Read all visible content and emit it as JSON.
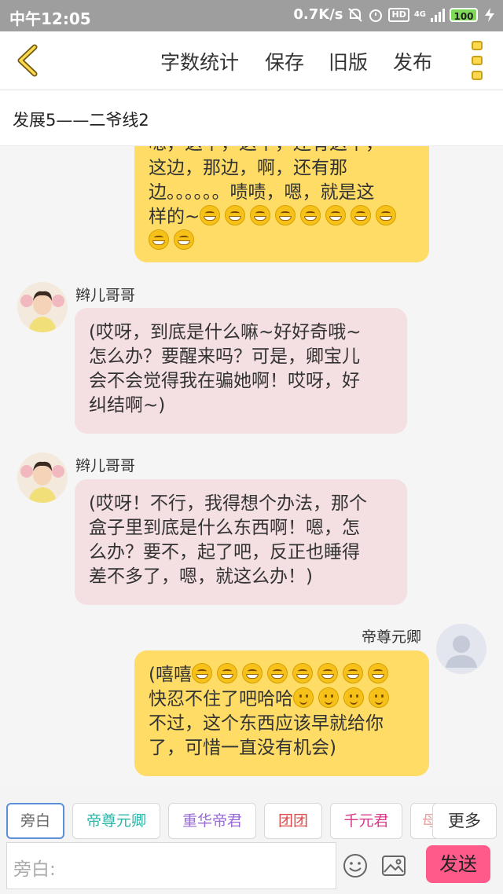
{
  "status_bar": {
    "time": "中午12:05",
    "net_speed": "0.7K/s",
    "network_type": "4G",
    "hd_badge": "HD",
    "battery": "100"
  },
  "app_bar": {
    "menu": {
      "word_count": "字数统计",
      "save": "保存",
      "old_version": "旧版",
      "publish": "发布"
    },
    "accent_color": "#ffd84d"
  },
  "chapter_title": "发展5——二爷线2",
  "messages": [
    {
      "side": "right",
      "speaker": "",
      "text": "嗯，这个，这个，还有这个，这边，那边，啊，还有那边。。。。。。啧啧，嗯，就是这样的~",
      "emoji": "grin x10",
      "color": "#ffdc66"
    },
    {
      "side": "left",
      "speaker": "辫儿哥哥",
      "text": "(哎呀，到底是什么嘛~好好奇哦~怎么办？要醒来吗？可是，卿宝儿会不会觉得我在骗她啊！哎呀，好纠结啊~)",
      "color": "#f4dfe2"
    },
    {
      "side": "left",
      "speaker": "辫儿哥哥",
      "text": "(哎呀！不行，我得想个办法，那个盒子里到底是什么东西啊！嗯，怎么办？要不，起了吧，反正也睡得差不多了，嗯，就这么办！)",
      "color": "#f4dfe2"
    },
    {
      "side": "right",
      "speaker": "帝尊元卿",
      "text_line1": "(嘻嘻",
      "text_line2": "快忍不住了吧哈哈",
      "text_line3": "不过，这个东西应该早就给你了，可惜一直没有机会)",
      "color": "#ffdc66"
    }
  ],
  "msg0_lines": [
    "嗯，这个，这个，还有这个，",
    "这边，那边，啊，还有那",
    "边。。。。。。啧啧，嗯，就是这",
    "样的~"
  ],
  "msg1_lines": [
    "(哎呀，到底是什么嘛~好好奇哦~",
    "怎么办？要醒来吗？可是，卿宝儿",
    "会不会觉得我在骗她啊！哎呀，好",
    "纠结啊~)"
  ],
  "msg2_lines": [
    "(哎呀！不行，我得想个办法，那个",
    "盒子里到底是什么东西啊！嗯，怎",
    "么办？要不，起了吧，反正也睡得",
    "差不多了，嗯，就这么办！)"
  ],
  "msg3_lines": [
    "(嘻嘻",
    "快忍不住了吧哈哈",
    "不过，这个东西应该早就给你",
    "了，可惜一直没有机会)"
  ],
  "roles": [
    {
      "label": "旁白",
      "color": "#666666"
    },
    {
      "label": "帝尊元卿",
      "color": "#2bb5a8"
    },
    {
      "label": "重华帝君",
      "color": "#9a6ad8"
    },
    {
      "label": "团团",
      "color": "#e04848"
    },
    {
      "label": "千元君",
      "color": "#d83a8a"
    },
    {
      "label": "母",
      "color": "#e8a0a0"
    }
  ],
  "more_label": "更多",
  "input": {
    "placeholder": "旁白:",
    "send_label": "发送"
  }
}
